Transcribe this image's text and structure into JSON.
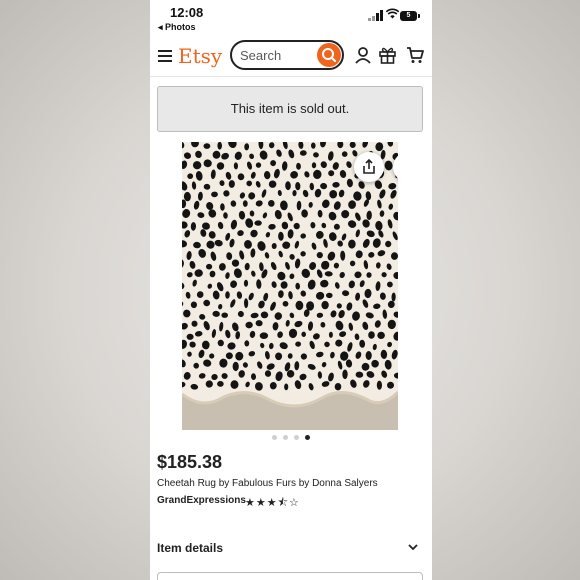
{
  "status_bar": {
    "time": "12:08",
    "back_app": "◂ Photos",
    "battery": "5"
  },
  "header": {
    "logo": "Etsy",
    "search_placeholder": "Search"
  },
  "banner": {
    "sold_out": "This item is sold out."
  },
  "icons": {
    "menu": "hamburger-menu-icon",
    "search": "search-icon",
    "account": "account-icon",
    "gift": "gift-icon",
    "cart": "cart-icon",
    "share": "share-icon",
    "favorite": "heart-icon",
    "expand": "chevron-down-icon"
  },
  "carousel": {
    "total": 4,
    "active": 4
  },
  "product": {
    "price": "$185.38",
    "title": "Cheetah Rug by Fabulous Furs by Donna Salyers",
    "shop": "GrandExpressions",
    "rating": 3.5,
    "stars_text": "★★★⯪☆"
  },
  "sections": {
    "item_details": "Item details"
  },
  "colors": {
    "brand": "#F1641E",
    "text": "#222222",
    "banner_bg": "#e8e8e8"
  }
}
